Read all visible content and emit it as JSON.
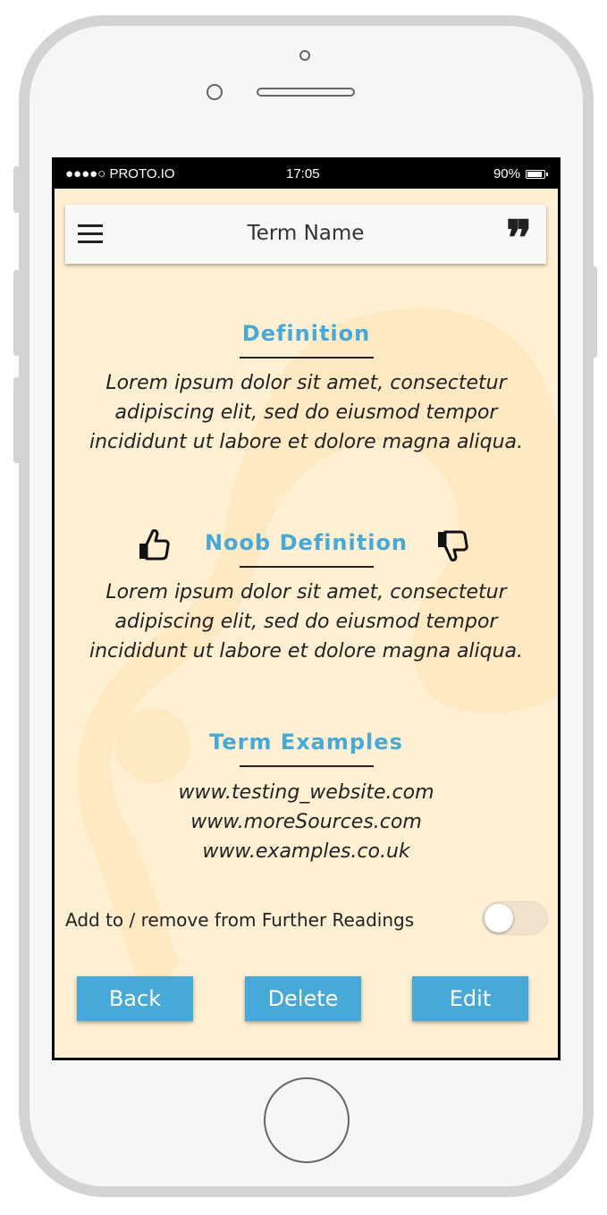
{
  "status_bar": {
    "carrier": "●●●●○ PROTO.IO",
    "time": "17:05",
    "battery": "90%"
  },
  "header": {
    "title": "Term Name",
    "menu_icon": "hamburger-menu-icon",
    "quote_icon": "quote-icon",
    "quote_glyph": "❞"
  },
  "definition": {
    "heading": "Definition",
    "text": "Lorem ipsum dolor sit amet, consectetur adipiscing elit, sed do eiusmod tempor incididunt ut labore et dolore magna aliqua."
  },
  "noob_definition": {
    "heading": "Noob Definition",
    "text": "Lorem ipsum dolor sit amet, consectetur adipiscing elit, sed do eiusmod tempor incididunt ut labore et dolore magna aliqua.",
    "upvote_icon": "thumbs-up-icon",
    "downvote_icon": "thumbs-down-icon"
  },
  "examples": {
    "heading": "Term Examples",
    "links": [
      "www.testing_website.com",
      "www.moreSources.com",
      "www.examples.co.uk"
    ]
  },
  "further_readings": {
    "label": "Add to / remove from Further Readings",
    "enabled": false
  },
  "actions": {
    "back": "Back",
    "delete": "Delete",
    "edit": "Edit"
  },
  "colors": {
    "accent": "#46a9d8",
    "background": "#fff0d3",
    "navbar": "#f8f8f8"
  }
}
